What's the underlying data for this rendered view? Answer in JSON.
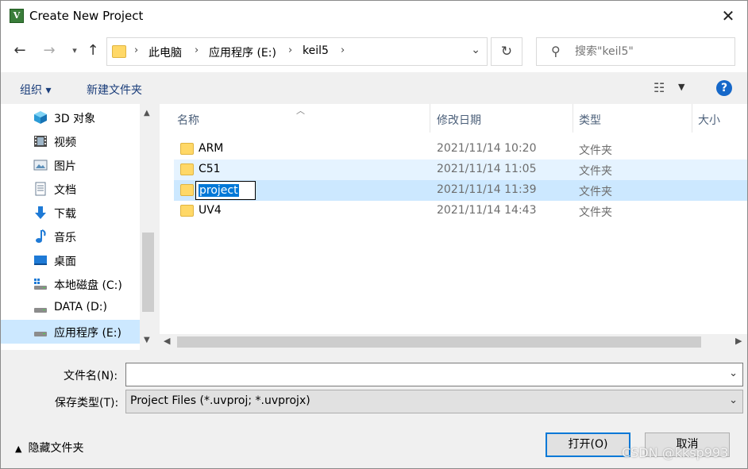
{
  "window": {
    "title": "Create New Project",
    "close_glyph": "✕"
  },
  "nav": {
    "back_glyph": "←",
    "forward_glyph": "→",
    "recent_glyph": "⌄",
    "up_glyph": "↑",
    "breadcrumb": [
      "此电脑",
      "应用程序 (E:)",
      "keil5"
    ],
    "refresh_glyph": "↻",
    "search_placeholder": "搜索\"keil5\""
  },
  "toolbar": {
    "organize_label": "组织 ▾",
    "new_folder_label": "新建文件夹",
    "help_label": "?"
  },
  "sidebar": {
    "items": [
      {
        "label": "3D 对象",
        "icon": "cube-icon"
      },
      {
        "label": "视频",
        "icon": "video-icon"
      },
      {
        "label": "图片",
        "icon": "pictures-icon"
      },
      {
        "label": "文档",
        "icon": "document-icon"
      },
      {
        "label": "下载",
        "icon": "download-icon"
      },
      {
        "label": "音乐",
        "icon": "music-icon"
      },
      {
        "label": "桌面",
        "icon": "desktop-icon"
      },
      {
        "label": "本地磁盘 (C:)",
        "icon": "system-drive-icon"
      },
      {
        "label": "DATA (D:)",
        "icon": "drive-icon"
      },
      {
        "label": "应用程序 (E:)",
        "icon": "drive-icon",
        "selected": true
      }
    ]
  },
  "filelist": {
    "columns": [
      "名称",
      "修改日期",
      "类型",
      "大小"
    ],
    "rows": [
      {
        "name": "ARM",
        "date": "2021/11/14 10:20",
        "type": "文件夹"
      },
      {
        "name": "C51",
        "date": "2021/11/14 11:05",
        "type": "文件夹"
      },
      {
        "name": "project",
        "date": "2021/11/14 11:39",
        "type": "文件夹"
      },
      {
        "name": "UV4",
        "date": "2021/11/14 14:43",
        "type": "文件夹"
      }
    ]
  },
  "form": {
    "filename_label": "文件名(N):",
    "filename_value": "",
    "filetype_label": "保存类型(T):",
    "filetype_value": "Project Files (*.uvproj; *.uvprojx)"
  },
  "footer": {
    "hide_folders_label": "隐藏文件夹",
    "open_label": "打开(O)",
    "cancel_label": "取消"
  },
  "watermark": "CSDN @kksp993",
  "colors": {
    "accent": "#0078d7",
    "selection": "#cce8ff",
    "hover": "#e5f3ff",
    "folder": "#ffd867"
  }
}
